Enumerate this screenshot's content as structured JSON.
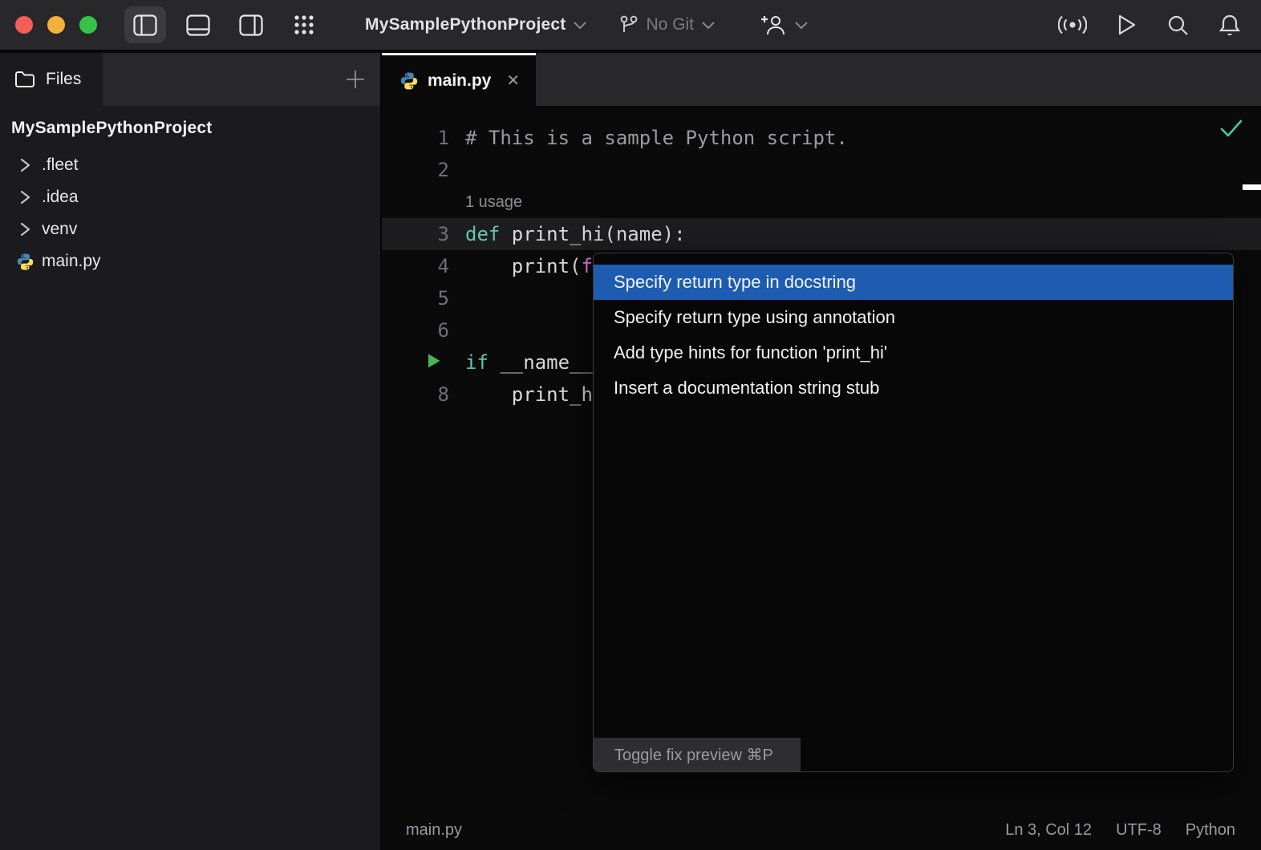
{
  "titlebar": {
    "project_name": "MySamplePythonProject",
    "git_label": "No Git"
  },
  "sidebar": {
    "files_tab_label": "Files",
    "project_root": "MySamplePythonProject",
    "tree": [
      {
        "label": ".fleet",
        "type": "folder"
      },
      {
        "label": ".idea",
        "type": "folder"
      },
      {
        "label": "venv",
        "type": "folder"
      },
      {
        "label": "main.py",
        "type": "python-file"
      }
    ]
  },
  "editor": {
    "tab_label": "main.py",
    "inlay_hint": "1 usage",
    "lines": [
      {
        "num": "1",
        "tokens": [
          {
            "t": "# This is a sample Python script.",
            "c": "comment"
          }
        ]
      },
      {
        "num": "2",
        "tokens": []
      },
      {
        "inlay": true
      },
      {
        "num": "3",
        "highlighted": true,
        "tokens": [
          {
            "t": "def",
            "c": "kw"
          },
          {
            "t": " print_hi(name):",
            "c": "plain"
          }
        ]
      },
      {
        "num": "4",
        "tokens": [
          {
            "t": "    print(",
            "c": "plain"
          },
          {
            "t": "f",
            "c": "f"
          }
        ]
      },
      {
        "num": "5",
        "tokens": []
      },
      {
        "num": "6",
        "tokens": []
      },
      {
        "num": "",
        "run": true,
        "tokens": [
          {
            "t": "if",
            "c": "kw"
          },
          {
            "t": " __name__",
            "c": "plain"
          }
        ]
      },
      {
        "num": "8",
        "tokens": [
          {
            "t": "    print_h",
            "c": "plain"
          }
        ]
      }
    ]
  },
  "popup": {
    "items": [
      {
        "label": "Specify return type in docstring",
        "selected": true
      },
      {
        "label": "Specify return type using annotation",
        "selected": false
      },
      {
        "label": "Add type hints for function 'print_hi'",
        "selected": false
      },
      {
        "label": "Insert a documentation string stub",
        "selected": false
      }
    ],
    "footer_label": "Toggle fix preview ⌘P"
  },
  "statusbar": {
    "file": "main.py",
    "position": "Ln 3, Col 12",
    "encoding": "UTF-8",
    "language": "Python"
  },
  "colors": {
    "selection_blue": "#1d5cb0",
    "keyword_teal": "#63c5ab",
    "fstring_magenta": "#e673dc",
    "run_green": "#44b854",
    "check_green": "#4ec6a2",
    "traffic_red": "#f25e5a",
    "traffic_yellow": "#f2b13d",
    "traffic_green": "#37c248"
  }
}
